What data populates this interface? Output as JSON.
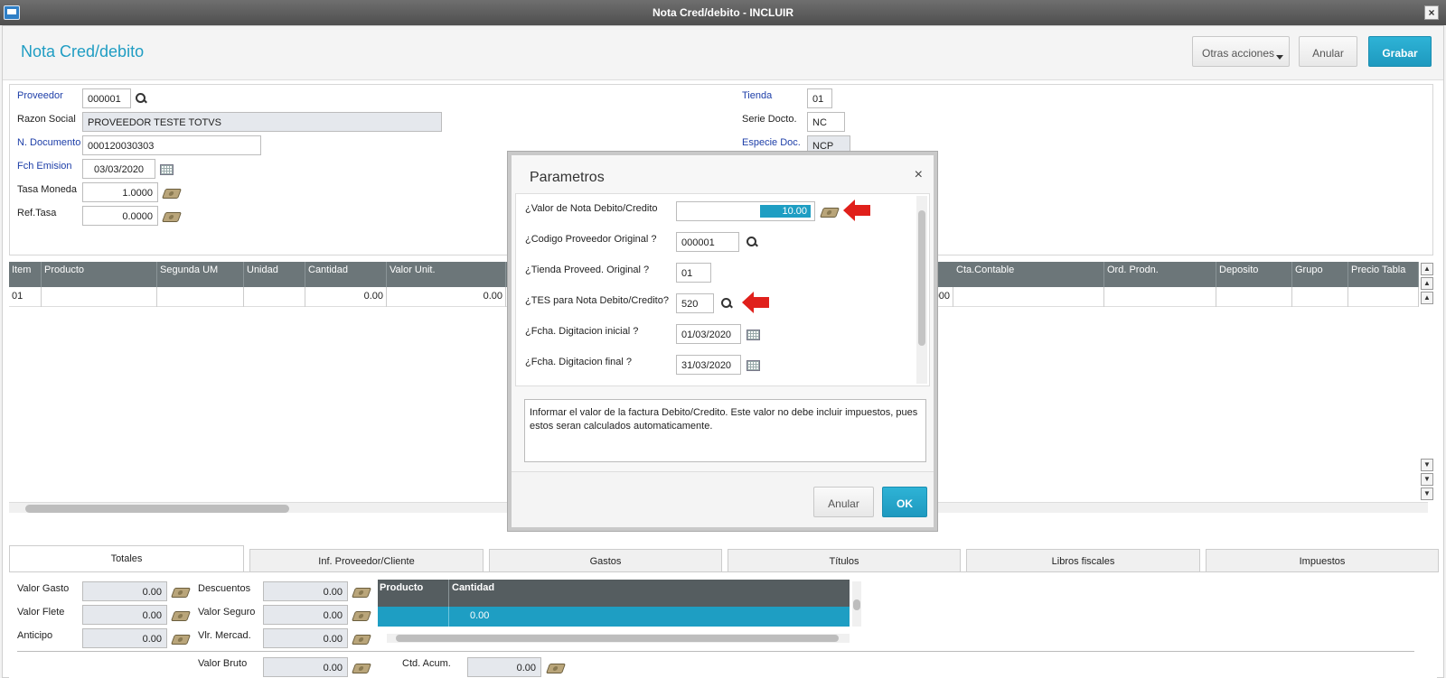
{
  "window": {
    "title": "Nota Cred/debito - INCLUIR",
    "close": "×"
  },
  "page": {
    "title": "Nota Cred/debito"
  },
  "toolbar": {
    "other_actions": "Otras acciones",
    "cancel": "Anular",
    "save": "Grabar"
  },
  "form": {
    "proveedor_label": "Proveedor",
    "proveedor_value": "000001",
    "razon_label": "Razon Social",
    "razon_value": "PROVEEDOR TESTE TOTVS",
    "ndoc_label": "N. Documento",
    "ndoc_value": "000120030303",
    "fch_label": "Fch Emision",
    "fch_value": "03/03/2020",
    "tasa_label": "Tasa Moneda",
    "tasa_value": "1.0000",
    "reftasa_label": "Ref.Tasa",
    "reftasa_value": "0.0000",
    "tienda_label": "Tienda",
    "tienda_value": "01",
    "serie_label": "Serie Docto.",
    "serie_value": "NC",
    "especie_label": "Especie Doc.",
    "especie_value": "NCP"
  },
  "grid": {
    "headers": [
      "Item",
      "Producto",
      "Segunda UM",
      "Unidad",
      "Cantidad",
      "Valor Unit.",
      "Cta.Contable",
      "Ord. Prodn.",
      "Deposito",
      "Grupo",
      "Precio Tabla"
    ],
    "row": {
      "item": "01",
      "cantidad": "0.00",
      "valor_unit": "0.00",
      "partial": "000"
    }
  },
  "tabs": [
    "Totales",
    "Inf. Proveedor/Cliente",
    "Gastos",
    "Títulos",
    "Libros fiscales",
    "Impuestos"
  ],
  "totals": {
    "valor_gasto_label": "Valor Gasto",
    "valor_gasto": "0.00",
    "valor_flete_label": "Valor Flete",
    "valor_flete": "0.00",
    "anticipo_label": "Anticipo",
    "anticipo": "0.00",
    "descuentos_label": "Descuentos",
    "descuentos": "0.00",
    "valor_seguro_label": "Valor Seguro",
    "valor_seguro": "0.00",
    "vlr_mercad_label": "Vlr. Mercad.",
    "vlr_mercad": "0.00",
    "valor_bruto_label": "Valor Bruto",
    "valor_bruto": "0.00",
    "ctd_acum_label": "Ctd. Acum.",
    "ctd_acum": "0.00",
    "mini_grid": {
      "headers": [
        "Producto",
        "Cantidad"
      ],
      "row_cantidad": "0.00"
    }
  },
  "modal": {
    "title": "Parametros",
    "close": "×",
    "params": [
      {
        "label": "¿Valor de Nota Debito/Credito",
        "value": "10.00"
      },
      {
        "label": "¿Codigo Proveedor Original ?",
        "value": "000001"
      },
      {
        "label": "¿Tienda Proveed. Original ?",
        "value": "01"
      },
      {
        "label": "¿TES para Nota Debito/Credito?",
        "value": "520"
      },
      {
        "label": "¿Fcha. Digitacion inicial ?",
        "value": "01/03/2020"
      },
      {
        "label": "¿Fcha. Digitacion final ?",
        "value": "31/03/2020"
      }
    ],
    "help_text": "Informar el valor de la factura Debito/Credito. Este valor no debe incluir impuestos, pues estos seran calculados automaticamente.",
    "cancel": "Anular",
    "ok": "OK"
  },
  "colors": {
    "accent": "#1f9dc3",
    "primary_button": "#1e99bf",
    "grid_header": "#6c7679",
    "arrow": "#e0201b"
  }
}
